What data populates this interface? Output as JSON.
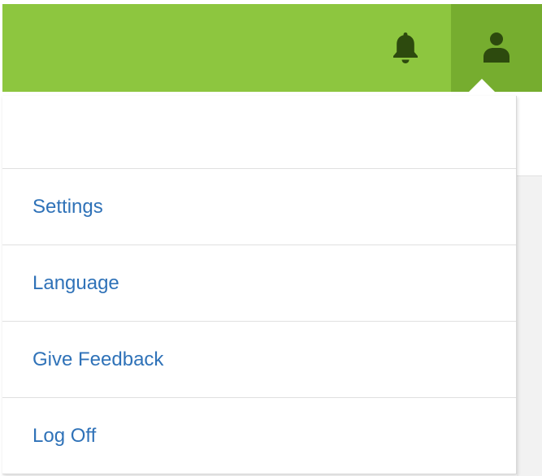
{
  "header": {
    "bg_color": "#8dc63f",
    "notifications_icon": "bell-icon",
    "user_icon": "user-icon",
    "icon_color": "#2d4a0e"
  },
  "user_menu": {
    "header_text": "",
    "items": [
      {
        "label": "Settings"
      },
      {
        "label": "Language"
      },
      {
        "label": "Give Feedback"
      },
      {
        "label": "Log Off"
      }
    ],
    "link_color": "#2f72b8"
  }
}
